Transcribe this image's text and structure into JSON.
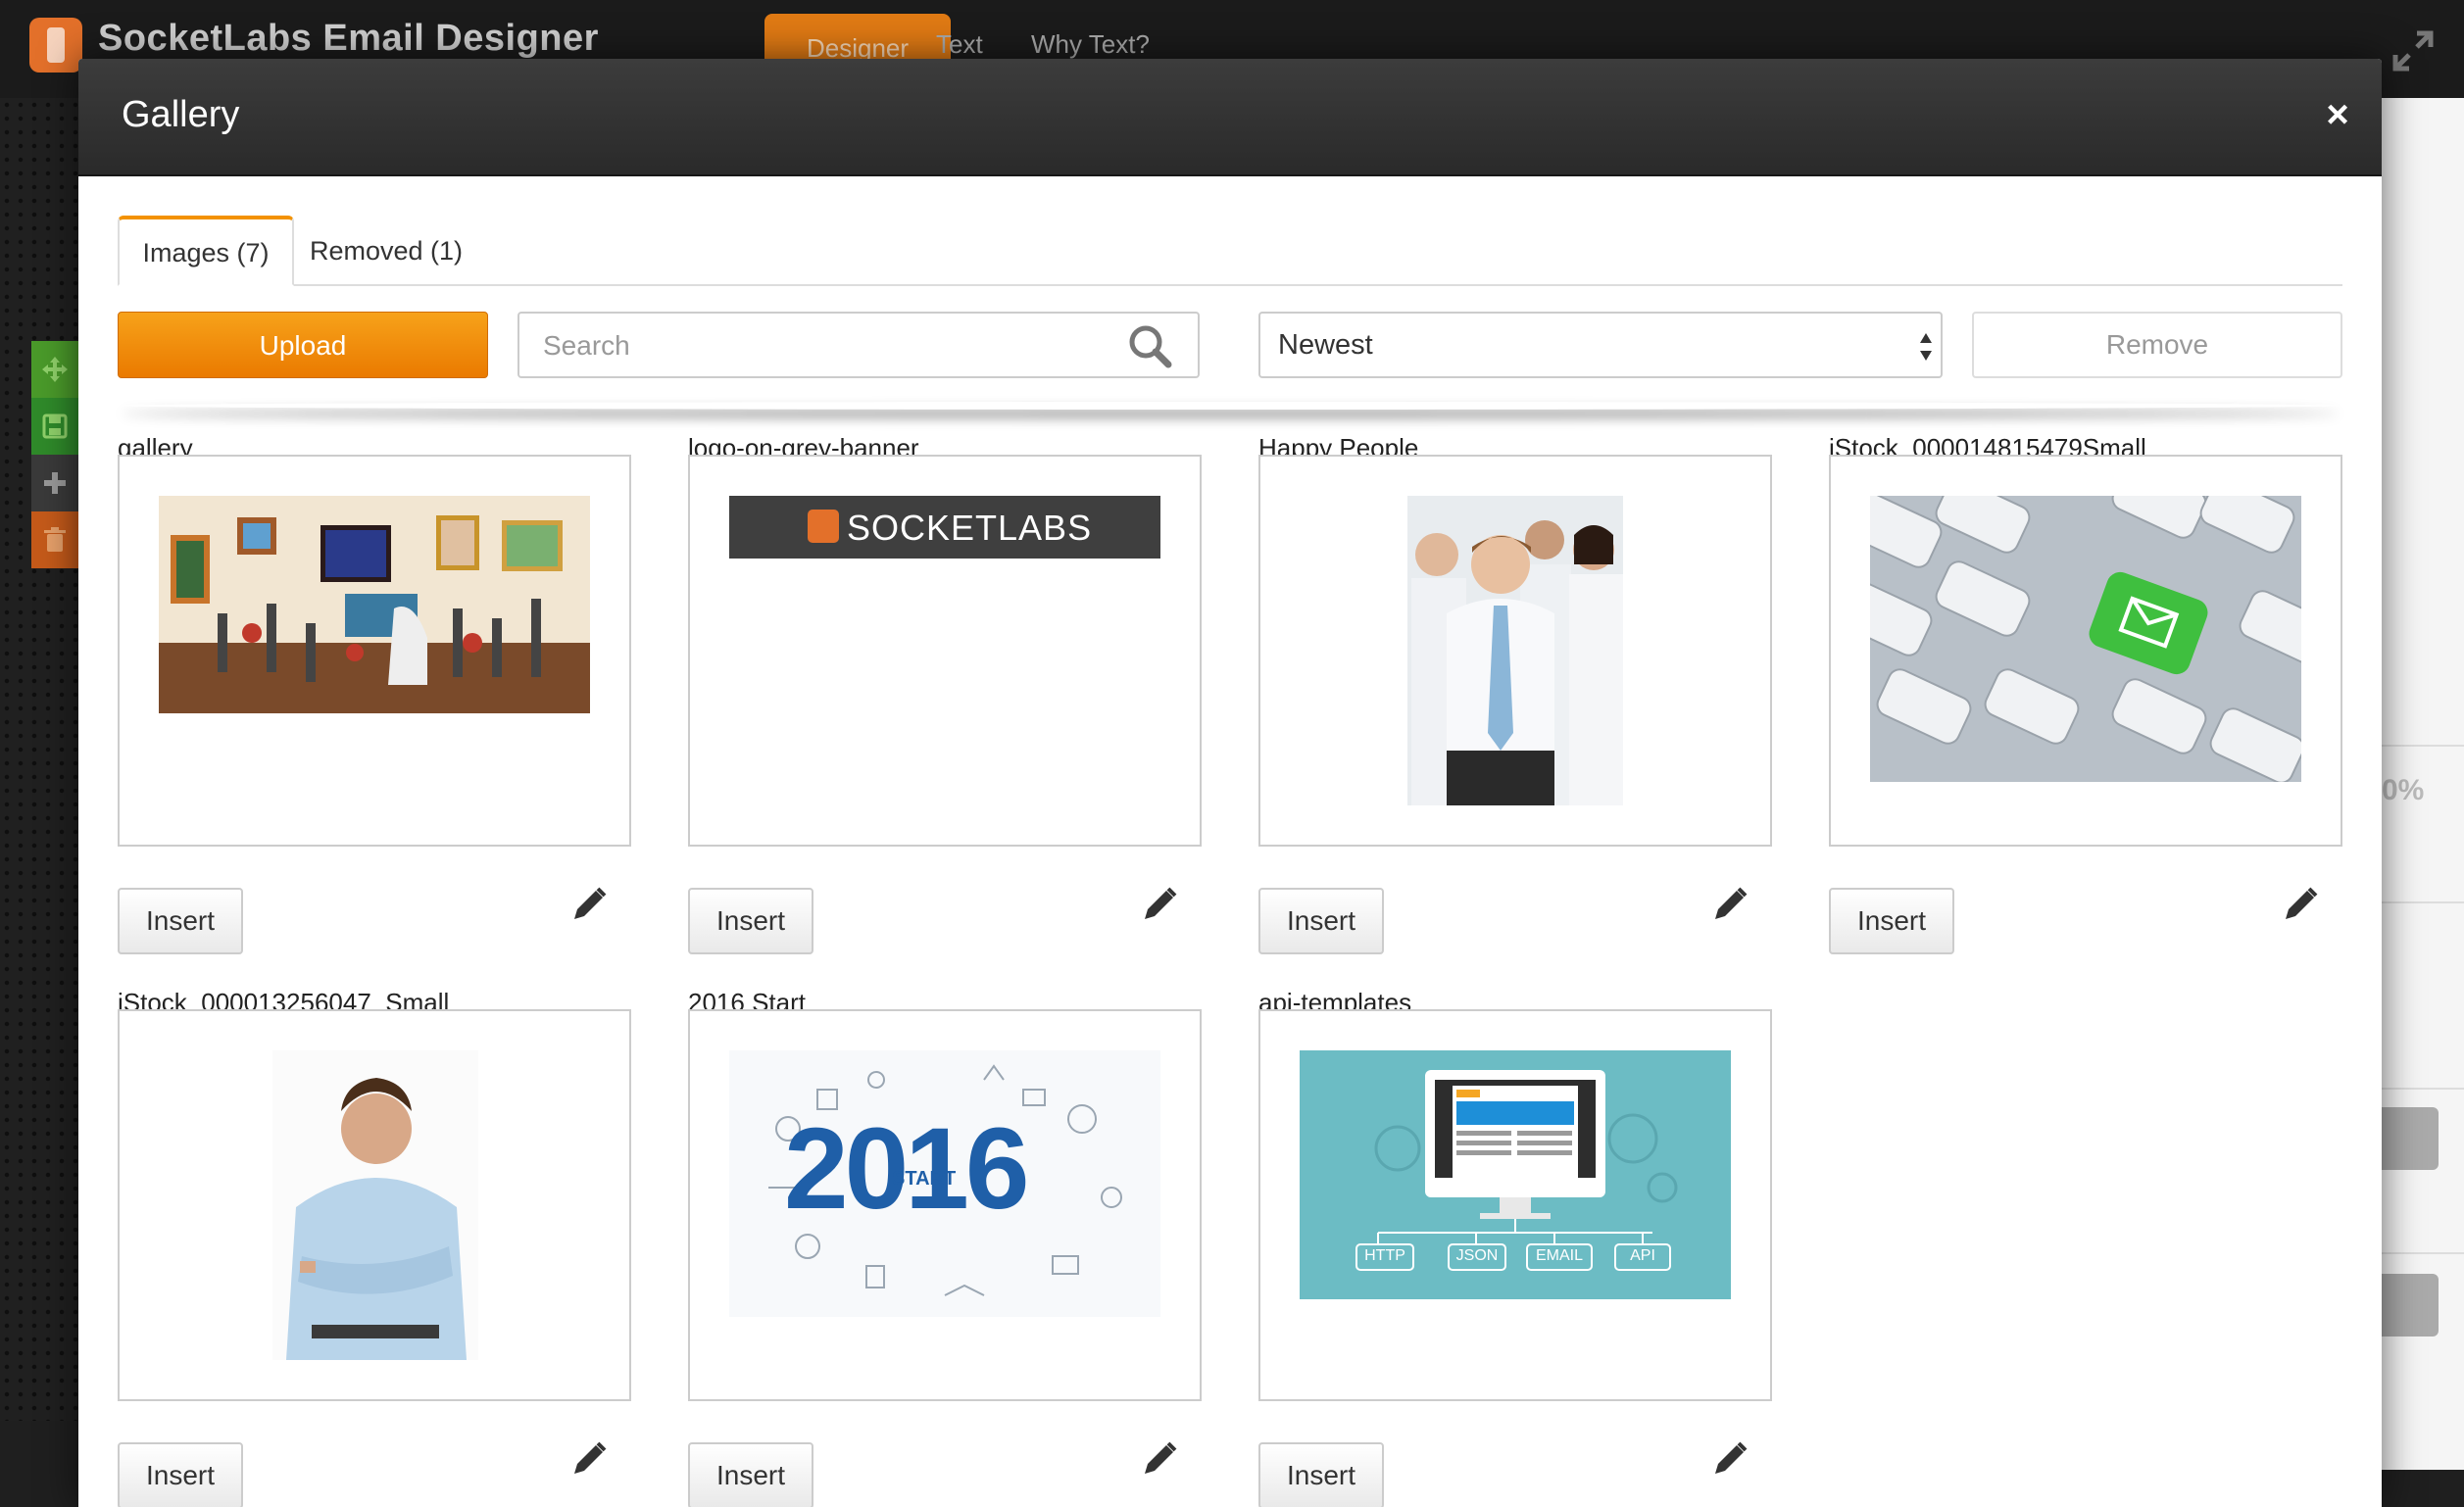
{
  "app": {
    "title": "SocketLabs Email Designer",
    "tabs": [
      "Designer",
      "Text",
      "Why Text?"
    ],
    "right_percent": "0%"
  },
  "modal": {
    "title": "Gallery",
    "close_label": "×",
    "tabs": [
      {
        "label": "Images (7)",
        "active": true
      },
      {
        "label": "Removed (1)",
        "active": false
      }
    ],
    "upload_label": "Upload",
    "search_placeholder": "Search",
    "sort_value": "Newest",
    "remove_label": "Remove"
  },
  "images": [
    {
      "name": "gallery",
      "insert_label": "Insert"
    },
    {
      "name": "logo-on-grey-banner",
      "insert_label": "Insert",
      "logo_text": "SOCKETLABS"
    },
    {
      "name": "Happy People",
      "insert_label": "Insert"
    },
    {
      "name": "iStock_000014815479Small",
      "insert_label": "Insert"
    },
    {
      "name": "iStock_000013256047_Small",
      "insert_label": "Insert"
    },
    {
      "name": "2016 Start",
      "insert_label": "Insert",
      "art_year": "2016",
      "art_word": "START"
    },
    {
      "name": "api-templates",
      "insert_label": "Insert",
      "art_tags": [
        "HTTP",
        "JSON",
        "EMAIL",
        "API"
      ]
    }
  ],
  "colors": {
    "accent": "#f39200",
    "header_bg": "#2f2f2f",
    "tool_green": "#4a9a2a",
    "tool_orange": "#c55a1a"
  }
}
